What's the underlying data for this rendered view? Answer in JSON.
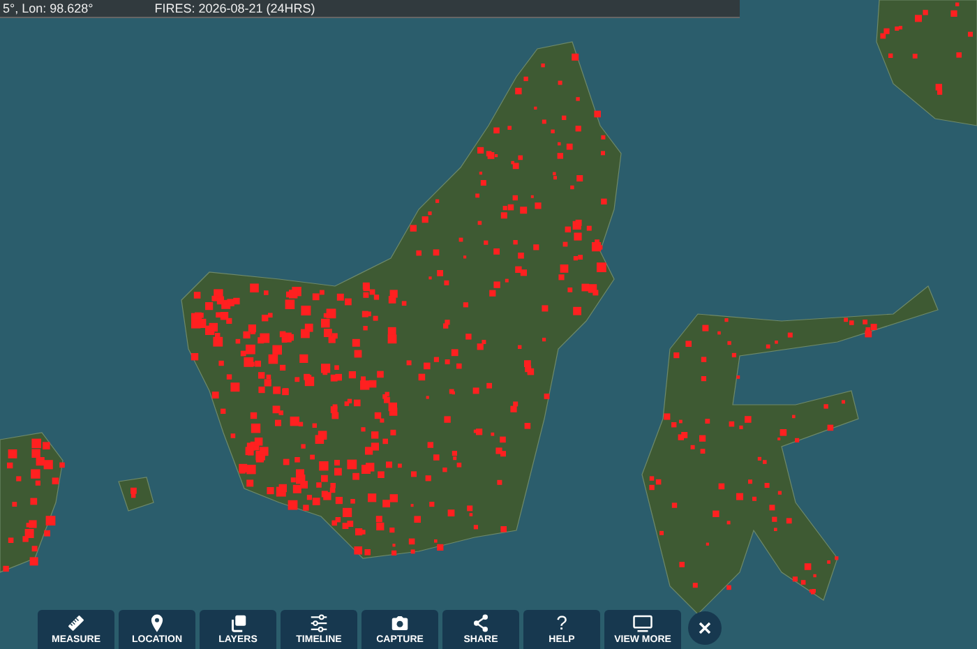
{
  "info_bar": {
    "coordinates": "5°, Lon: 98.628°",
    "fires": "FIRES: 2026-08-21 (24HRS)"
  },
  "toolbar": {
    "buttons": [
      {
        "label": "MEASURE",
        "kind": "ruler"
      },
      {
        "label": "LOCATION",
        "kind": "pin"
      },
      {
        "label": "LAYERS",
        "kind": "layers"
      },
      {
        "label": "TIMELINE",
        "kind": "sliders"
      },
      {
        "label": "CAPTURE",
        "kind": "camera"
      },
      {
        "label": "SHARE",
        "kind": "share"
      },
      {
        "label": "HELP",
        "kind": "glyph",
        "glyph": "?"
      },
      {
        "label": "VIEW MORE",
        "kind": "monitor"
      }
    ]
  }
}
